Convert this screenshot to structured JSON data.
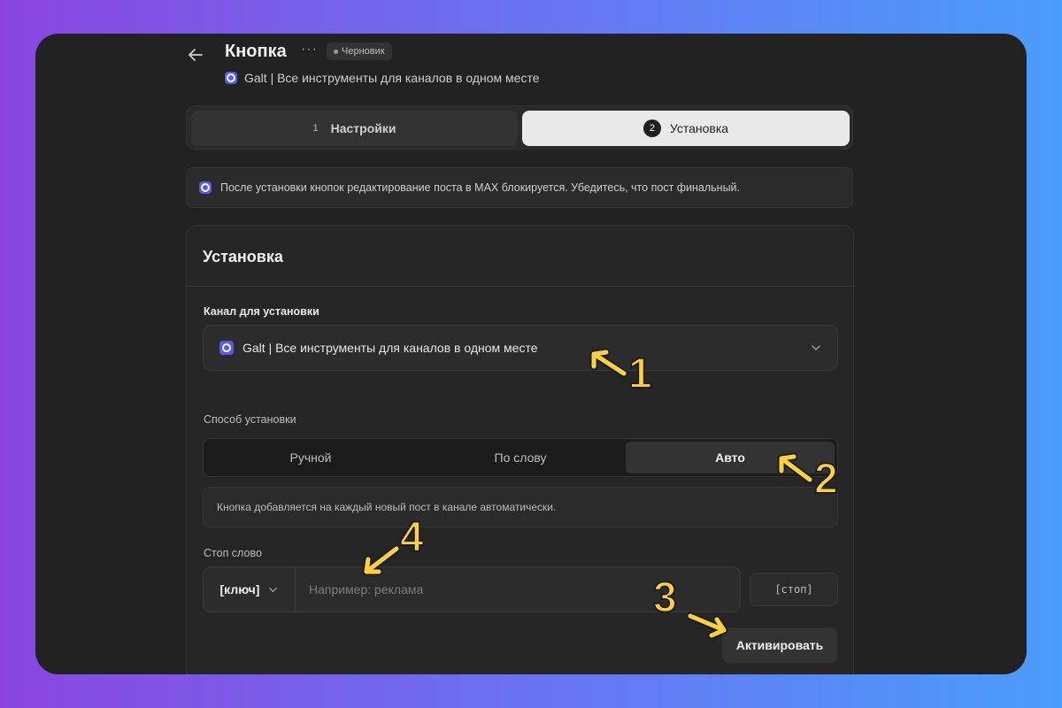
{
  "header": {
    "title": "Кнопка",
    "more_icon": "more-horizontal-icon",
    "status": "Черновик",
    "channel": "Galt | Все инструменты для каналов в одном месте"
  },
  "stepper": {
    "steps": [
      {
        "number": "1",
        "label": "Настройки"
      },
      {
        "number": "2",
        "label": "Установка",
        "active": true
      }
    ]
  },
  "notice": {
    "text": "После установки кнопок редактирование поста в MAX блокируется. Убедитесь, что пост финальный."
  },
  "install_card": {
    "title": "Установка",
    "channel_label": "Канал для установки",
    "channel_value": "Galt | Все инструменты для каналов в одном месте",
    "method_label": "Способ установки",
    "methods": [
      "Ручной",
      "По слову",
      "Авто"
    ],
    "selected_method": "Авто",
    "method_description": "Кнопка добавляется на каждый новый пост в канале автоматически.",
    "stop_word_label": "Стоп слово",
    "key_select_value": "[ключ]",
    "stop_word_placeholder": "Например: реклама",
    "stop_tag": "[стоп]",
    "activate_label": "Активировать"
  },
  "annotations": [
    "1",
    "2",
    "3",
    "4"
  ],
  "colors": {
    "accent": "#5b57f5",
    "annotation": "#ffd23c",
    "background_gradient_start": "#8a45e0",
    "background_gradient_end": "#4a9dfc"
  }
}
